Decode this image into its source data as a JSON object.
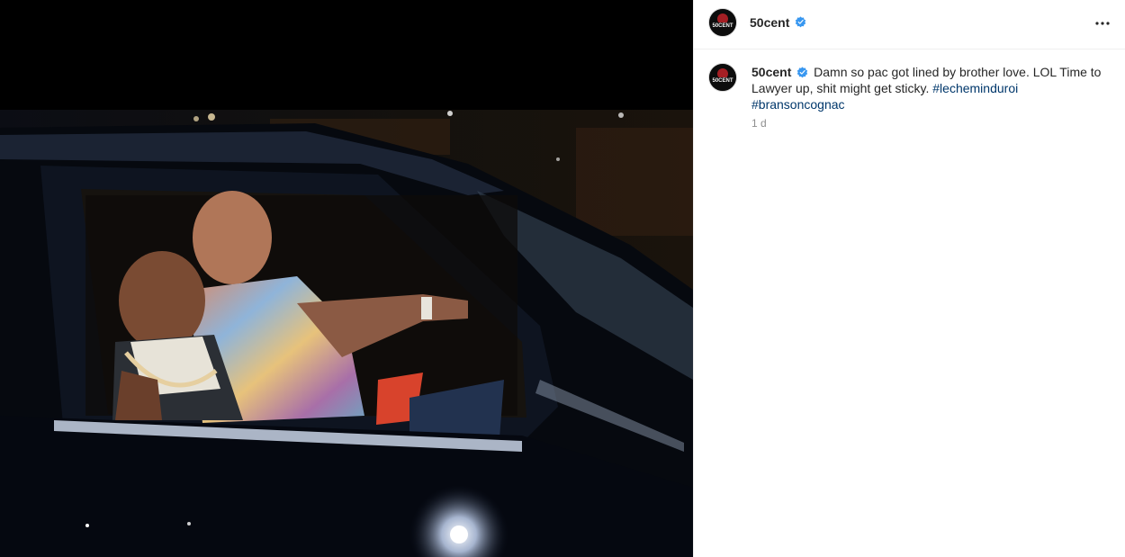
{
  "post": {
    "username": "50cent",
    "verified": true,
    "avatar_text": "50CENT",
    "more_icon": "more-horizontal-icon",
    "caption": {
      "username": "50cent",
      "text": "Damn so pac got lined by brother love. LOL Time to Lawyer up, shit might get sticky.",
      "hashtags": [
        "#lecheminduroi",
        "#bransoncognac"
      ]
    },
    "time_ago": "1 d"
  },
  "colors": {
    "verified_blue": "#3897f0",
    "hashtag": "#00376b",
    "muted": "#8e8e8e",
    "divider": "#efefef"
  }
}
